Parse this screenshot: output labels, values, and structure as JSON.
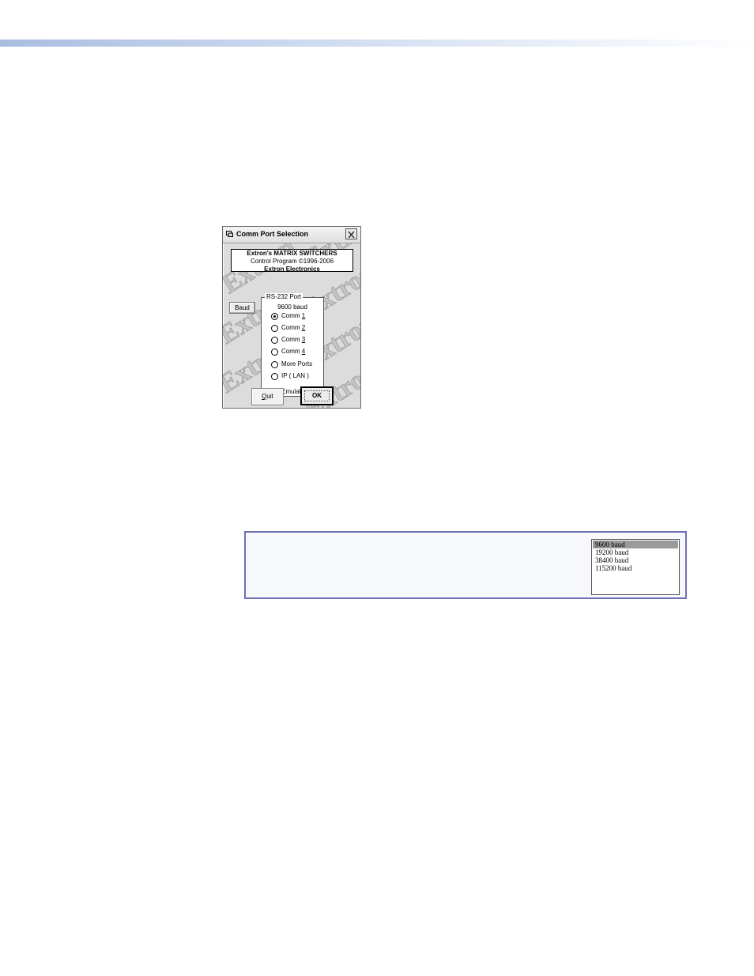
{
  "dialog": {
    "title": "Comm Port Selection",
    "info": {
      "line1": "Extron's MATRIX SWITCHERS",
      "line2": "Control Program   ©1996-2006",
      "line3": "Extron Electronics"
    },
    "watermark_text": "Extron",
    "baud_button": "Baud",
    "port_group": {
      "legend": "RS-232 Port",
      "baud_readout": "9600 baud",
      "options": [
        {
          "prefix": "Comm ",
          "key": "1",
          "checked": true
        },
        {
          "prefix": "Comm ",
          "key": "2",
          "checked": false
        },
        {
          "prefix": "Comm ",
          "key": "3",
          "checked": false
        },
        {
          "prefix": "Comm ",
          "key": "4",
          "checked": false
        },
        {
          "prefix": "More Ports",
          "key": "",
          "checked": false
        },
        {
          "prefix": "IP  ( LAN )",
          "key": "",
          "checked": false
        },
        {
          "prefix": "Emulate",
          "key": "",
          "checked": false
        }
      ]
    },
    "quit_button": {
      "key": "Q",
      "rest": "uit"
    },
    "ok_button": "OK"
  },
  "baud_list": {
    "items": [
      "9600 baud",
      "19200 baud",
      "38400 baud",
      "115200 baud"
    ],
    "selected_index": 0
  },
  "colors": {
    "header_rule": "#a9bde0",
    "note_border": "#6f6fb4",
    "list_selection": "#9a9a9a"
  }
}
